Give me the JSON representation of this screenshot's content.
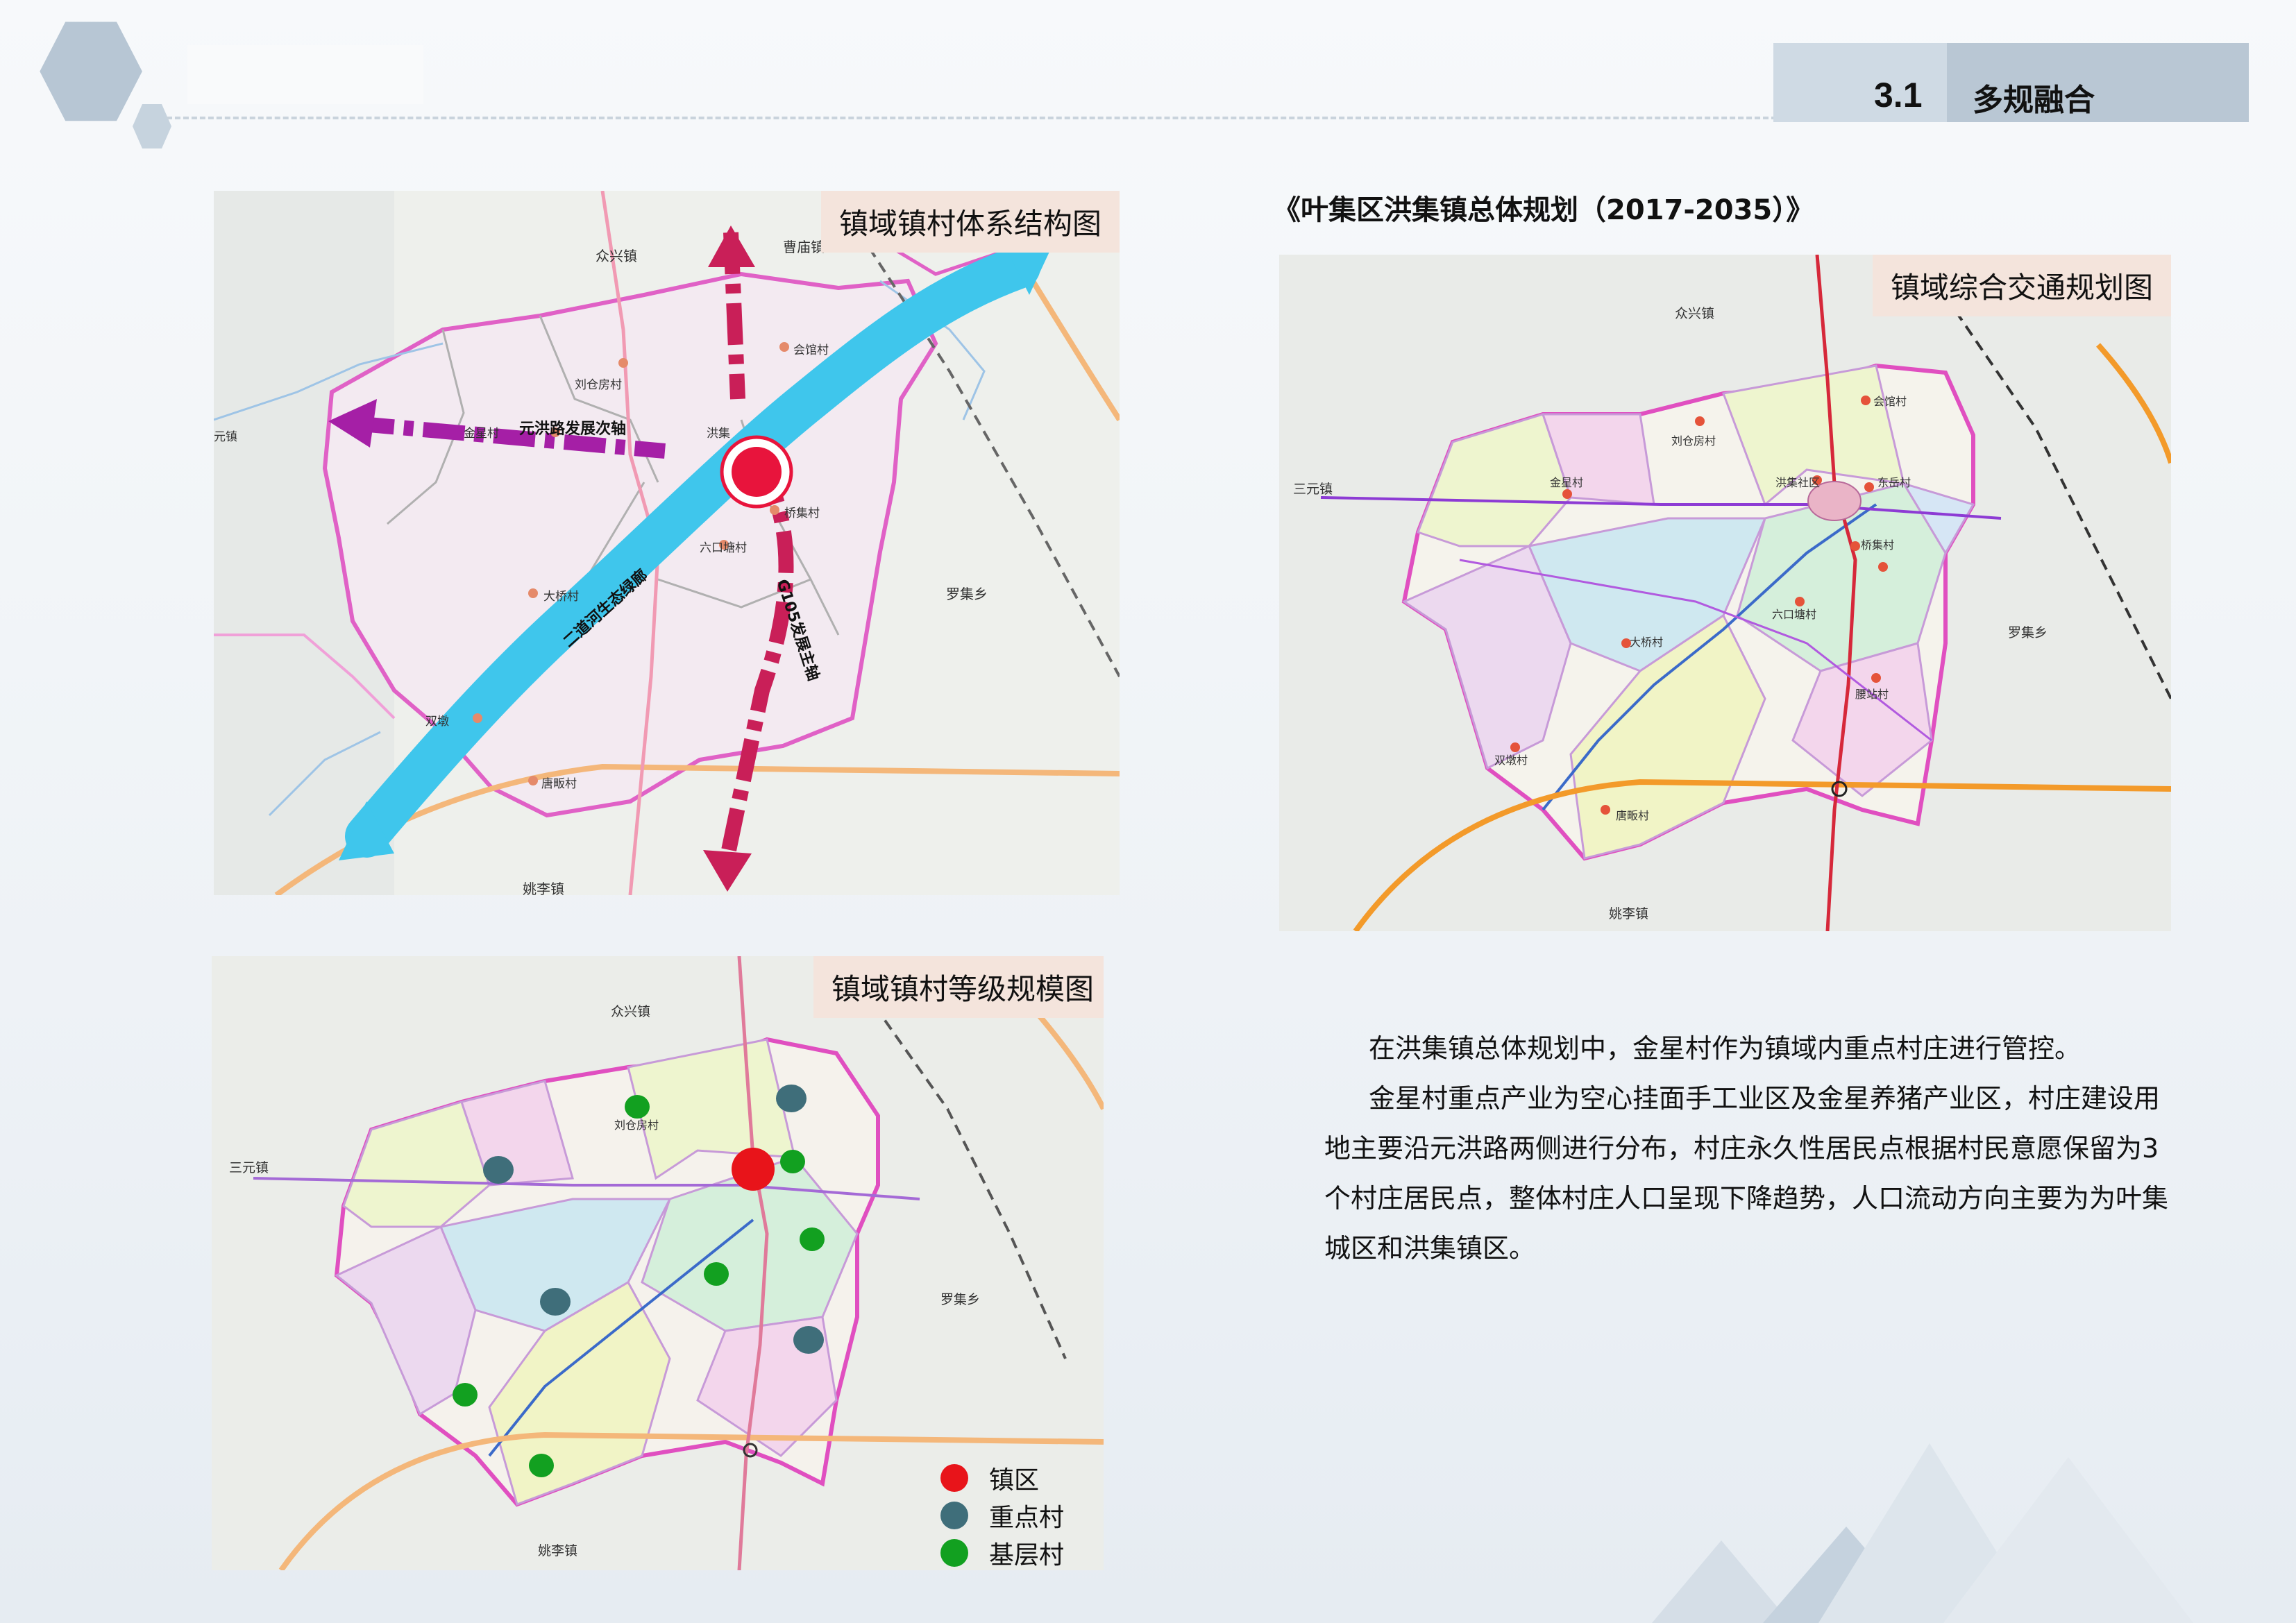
{
  "header": {
    "section_number": "3.1",
    "section_title": "多规融合"
  },
  "doc_title": "《叶集区洪集镇总体规划（2017-2035）》",
  "map1": {
    "label": "镇域镇村体系结构图",
    "place_labels": [
      "众兴镇",
      "曹庙镇",
      "会馆村",
      "刘仓房村",
      "金星村",
      "洪集",
      "元镇",
      "六口塘村",
      "桥集村",
      "大桥村",
      "罗集乡",
      "双墩",
      "唐畈村",
      "姚李镇"
    ],
    "axis_labels": [
      "元洪路发展次轴",
      "G105发展主轴",
      "二道河生态绿廊"
    ]
  },
  "map2": {
    "label": "镇域综合交通规划图",
    "place_labels": [
      "众兴镇",
      "会馆村",
      "刘仓房村",
      "三元镇",
      "金星村",
      "洪集社区",
      "东岳村",
      "桥集村",
      "六口塘村",
      "大桥村",
      "罗集乡",
      "腰站村",
      "双墩村",
      "唐畈村",
      "姚李镇"
    ]
  },
  "map3": {
    "label": "镇域镇村等级规模图",
    "place_labels": [
      "众兴镇",
      "刘仓房村",
      "三元镇",
      "罗集乡",
      "姚李镇"
    ],
    "legend": [
      {
        "label": "镇区",
        "color": "#e8141a"
      },
      {
        "label": "重点村",
        "color": "#3f6e7a"
      },
      {
        "label": "基层村",
        "color": "#12a020"
      }
    ]
  },
  "body": {
    "p1": "在洪集镇总体规划中，金星村作为镇域内重点村庄进行管控。",
    "p2": "金星村重点产业为空心挂面手工业区及金星养猪产业区，村庄建设用地主要沿元洪路两侧进行分布，村庄永久性居民点根据村民意愿保留为3个村庄居民点，整体村庄人口呈现下降趋势，人口流动方向主要为为叶集城区和洪集镇区。"
  }
}
